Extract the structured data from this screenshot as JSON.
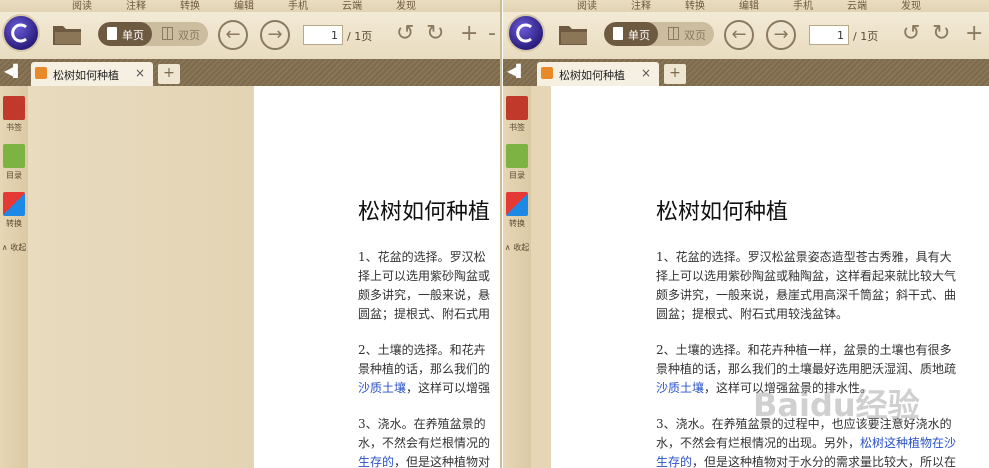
{
  "menu": {
    "tabs": [
      "阅读",
      "注释",
      "转换",
      "编辑",
      "手机",
      "云端",
      "发现"
    ]
  },
  "toolbar": {
    "view_single": "单页",
    "view_double": "双页",
    "current_page": "1",
    "total_pages": "/ 1页"
  },
  "tab": {
    "title": "松树如何种植",
    "close": "×",
    "add": "+",
    "collapse": "◀▌"
  },
  "sidebar": {
    "bookmark": "书签",
    "toc": "目录",
    "convert": "转换",
    "collapse": "∧ 收起"
  },
  "left_doc": {
    "title": "松树如何种植",
    "p1": [
      "1、花盆的选择。罗汉松",
      "择上可以选用紫砂陶盆或",
      "颇多讲究，一般来说，悬",
      "圆盆；提根式、附石式用"
    ],
    "p2a": [
      "2、土壤的选择。和花卉",
      "景种植的话，那么我们的"
    ],
    "p2b_hl": "沙质土壤",
    "p2b_rest": "，这样可以增强",
    "p3a": [
      "3、浇水。在养殖盆景的",
      "水，不然会有烂根情况的"
    ],
    "p3b_hl": "生存的",
    "p3b_rest": "，但是这种植物对"
  },
  "right_doc": {
    "title": "松树如何种植",
    "p1": [
      "1、花盆的选择。罗汉松盆景姿态造型苍古秀雅，具有大",
      "择上可以选用紫砂陶盆或釉陶盆，这样看起来就比较大气",
      "颇多讲究，一般来说，悬崖式用高深千筒盆；斜干式、曲",
      "圆盆；提根式、附石式用较浅盆钵。"
    ],
    "p2a": [
      "2、土壤的选择。和花卉种植一样，盆景的土壤也有很多",
      "景种植的话，那么我们的土壤最好选用肥沃湿润、质地疏"
    ],
    "p2b_hl": "沙质土壤",
    "p2b_rest": "，这样可以增强盆景的排水性。",
    "p3a": [
      "3、浇水。在养殖盆景的过程中，也应该要注意好浇水的",
      "水，不然会有烂根情况的出现。另外，"
    ],
    "p3a_hl": "松树这种植物在沙",
    "p3b_hl": "生存的",
    "p3b_rest": "，但是这种植物对于水分的需求量比较大，所以在"
  },
  "watermark": "Baidu经验"
}
